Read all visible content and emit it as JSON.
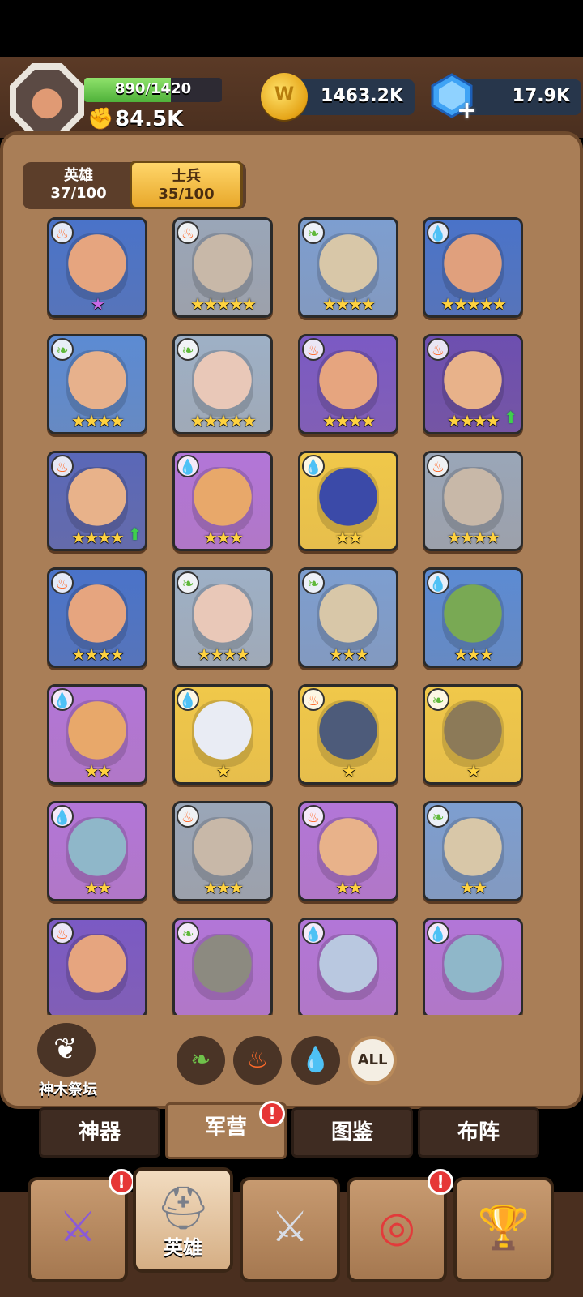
{
  "player": {
    "xp_text": "890/1420",
    "xp_progress": 0.627,
    "power": "84.5K"
  },
  "currency": {
    "gold": "1463.2K",
    "gems": "17.9K"
  },
  "toggle": {
    "heroes_label": "英雄",
    "heroes_count": "37/100",
    "soldiers_label": "士兵",
    "soldiers_count": "35/100"
  },
  "units": [
    {
      "element": "fire",
      "stars": "★",
      "bg": "#4a73c9",
      "face": "#e6a57f",
      "up": false
    },
    {
      "element": "fire",
      "stars": "★★★★★",
      "bg": "#9aa6b8",
      "face": "#c8b8a8",
      "up": false
    },
    {
      "element": "leaf",
      "stars": "★★★★",
      "bg": "#7d9ed0",
      "face": "#d8c7a8",
      "up": false
    },
    {
      "element": "water",
      "stars": "★★★★★",
      "bg": "#4a73c9",
      "face": "#e0a07d",
      "up": false
    },
    {
      "element": "leaf",
      "stars": "★★★★",
      "bg": "#5c8bd3",
      "face": "#e7b18c",
      "up": false
    },
    {
      "element": "leaf",
      "stars": "★★★★★",
      "bg": "#9eb0c6",
      "face": "#e9c8b8",
      "up": false
    },
    {
      "element": "fire",
      "stars": "★★★★",
      "bg": "#7b5ac4",
      "face": "#e6a57f",
      "up": false
    },
    {
      "element": "fire",
      "stars": "★★★★",
      "bg": "#6d4fb0",
      "face": "#e8b28a",
      "up": true
    },
    {
      "element": "fire",
      "stars": "★★★★",
      "bg": "#5a68b8",
      "face": "#e8b28a",
      "up": true
    },
    {
      "element": "water",
      "stars": "★★★",
      "bg": "#b276d8",
      "face": "#e8a86a",
      "up": false
    },
    {
      "element": "water",
      "stars": "★★",
      "bg": "#f0c84a",
      "face": "#3b4aa8",
      "up": false
    },
    {
      "element": "fire",
      "stars": "★★★★",
      "bg": "#9aa6b8",
      "face": "#c8b8a8",
      "up": false
    },
    {
      "element": "fire",
      "stars": "★★★★",
      "bg": "#4a73c9",
      "face": "#e6a57f",
      "up": false
    },
    {
      "element": "leaf",
      "stars": "★★★★",
      "bg": "#9eb0c6",
      "face": "#e9c8b8",
      "up": false
    },
    {
      "element": "leaf",
      "stars": "★★★",
      "bg": "#7d9ed0",
      "face": "#d8c7a8",
      "up": false
    },
    {
      "element": "water",
      "stars": "★★★",
      "bg": "#5c8bd3",
      "face": "#79a954",
      "up": false
    },
    {
      "element": "water",
      "stars": "★★",
      "bg": "#b276d8",
      "face": "#e8a86a",
      "up": false
    },
    {
      "element": "water",
      "stars": "★",
      "bg": "#f0c84a",
      "face": "#e9ecf4",
      "up": false
    },
    {
      "element": "fire",
      "stars": "★",
      "bg": "#f0c84a",
      "face": "#4d5b7a",
      "up": false
    },
    {
      "element": "leaf",
      "stars": "★",
      "bg": "#f0c84a",
      "face": "#8c7a58",
      "up": false
    },
    {
      "element": "water",
      "stars": "★★",
      "bg": "#b276d8",
      "face": "#8fb7c9",
      "up": false
    },
    {
      "element": "fire",
      "stars": "★★★",
      "bg": "#9aa6b8",
      "face": "#c8b8a8",
      "up": false
    },
    {
      "element": "fire",
      "stars": "★★",
      "bg": "#b276d8",
      "face": "#e8b28a",
      "up": false
    },
    {
      "element": "leaf",
      "stars": "★★",
      "bg": "#7d9ed0",
      "face": "#d8c7a8",
      "up": false
    },
    {
      "element": "fire",
      "stars": "",
      "bg": "#7b5ac4",
      "face": "#e6a57f",
      "up": false
    },
    {
      "element": "leaf",
      "stars": "",
      "bg": "#b276d8",
      "face": "#8c8a80",
      "up": false
    },
    {
      "element": "water",
      "stars": "",
      "bg": "#b276d8",
      "face": "#b9c8e0",
      "up": false
    },
    {
      "element": "water",
      "stars": "",
      "bg": "#b276d8",
      "face": "#8fb7c9",
      "up": false
    }
  ],
  "altar": {
    "label": "神木祭坛"
  },
  "filters": {
    "all_label": "ALL"
  },
  "subtabs": [
    "神器",
    "军营",
    "图鉴",
    "布阵"
  ],
  "subtab_active": 1,
  "bottom_nav": [
    {
      "icon": "sword-banner-icon",
      "label": "",
      "badge": "!"
    },
    {
      "icon": "viking-helmet-icon",
      "label": "英雄",
      "badge": ""
    },
    {
      "icon": "crossed-swords-icon",
      "label": "",
      "badge": ""
    },
    {
      "icon": "target-icon",
      "label": "",
      "badge": "!"
    },
    {
      "icon": "trophy-icon",
      "label": "",
      "badge": ""
    }
  ],
  "badges": {
    "barracks": "!"
  },
  "colors": {
    "panel": "#a97e57",
    "accent_gold": "#ffd66a",
    "bar_green": "#4fb13a"
  }
}
